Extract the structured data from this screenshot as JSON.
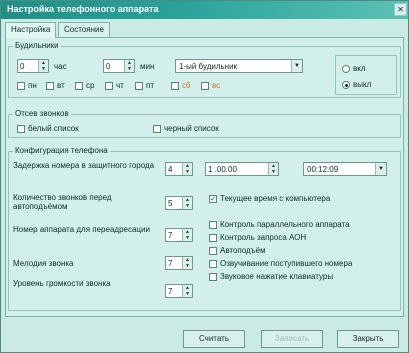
{
  "window": {
    "title": "Настройка телефонного аппарата",
    "close": "✕"
  },
  "tabs": [
    {
      "label": "Настройка"
    },
    {
      "label": "Состояние"
    }
  ],
  "alarm": {
    "group_title": "Будильники",
    "hours_value": "0",
    "hours_label": "час",
    "minutes_value": "0",
    "minutes_label": "мин",
    "select_value": "1-ый будильник",
    "days": [
      "пн",
      "вт",
      "ср",
      "чт",
      "пт",
      "сб",
      "вс"
    ],
    "weekend_color": "#d07a20",
    "radio_on": "вкл",
    "radio_off": "выкл"
  },
  "rejection": {
    "group_title": "Отсев звонков",
    "whitelist": "белый список",
    "blacklist": "черный список"
  },
  "config": {
    "group_title": "Конфигурация телефона",
    "delay_label": "Задержка номера в защитного города",
    "delay_value": "4",
    "date_value": "1 .00.00",
    "time_value": "00:12:09",
    "rings_label": "Количество звонков перед автоподъёмом",
    "rings_value": "5",
    "current_time_label": "Текущее время с компьютера",
    "redial_label": "Номер аппарата для переадресации",
    "redial_value": "7",
    "melody_label": "Мелодия звонка",
    "melody_value": "7",
    "volume_label": "Уровень громкости звонка",
    "volume_value": "7",
    "options": [
      {
        "label": "Контроль параллельного аппарата",
        "checked": false
      },
      {
        "label": "Контроль запроса АОН",
        "checked": false
      },
      {
        "label": "Автоподъём",
        "checked": false
      },
      {
        "label": "Озвучивание поступившего номера",
        "checked": false
      },
      {
        "label": "Звуковое нажатие клавиатуры",
        "checked": false
      }
    ]
  },
  "buttons": {
    "read": "Считать",
    "write": "Записать",
    "close": "Закрыть"
  },
  "colors": {
    "titlebar": "#1f8f86",
    "background": "#c9ebe4"
  }
}
